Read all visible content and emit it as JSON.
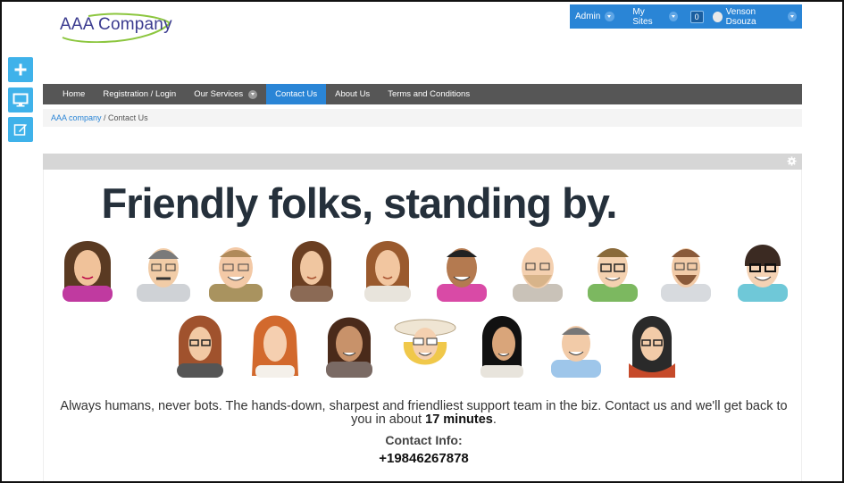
{
  "logo": {
    "text": "AAA Company"
  },
  "userbar": {
    "admin": "Admin",
    "my_sites": "My Sites",
    "notifications": "0",
    "user": "Venson Dsouza"
  },
  "tools": {
    "add_icon": "plus-icon",
    "preview_icon": "monitor-icon",
    "edit_icon": "edit-icon"
  },
  "nav": {
    "items": [
      {
        "label": "Home"
      },
      {
        "label": "Registration / Login"
      },
      {
        "label": "Our Services"
      },
      {
        "label": "Contact Us"
      },
      {
        "label": "About Us"
      },
      {
        "label": "Terms and Conditions"
      }
    ],
    "active": "Contact Us"
  },
  "breadcrumb": {
    "root": "AAA company",
    "separator": " / ",
    "current": "Contact Us"
  },
  "content": {
    "headline": "Friendly folks, standing by.",
    "tagline_pre": "Always humans, never bots. The hands-down, sharpest and friendliest support team in the biz. Contact us and we'll get back to you in about ",
    "tagline_bold": "17 minutes",
    "tagline_post": ".",
    "contact_label": "Contact Info:",
    "phone": "+19846267878"
  },
  "colors": {
    "accent": "#2a85d6",
    "nav_bg": "#565656",
    "tool_bg": "#3fb2ea",
    "headline": "#25303b"
  }
}
